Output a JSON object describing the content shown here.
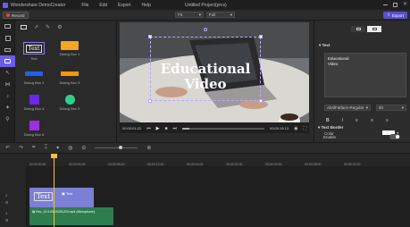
{
  "app": {
    "title": "Wondershare DemoCreator",
    "menus": [
      "File",
      "Edit",
      "Export",
      "Help"
    ],
    "project": "Untitled Project(prcs)"
  },
  "toolbar": {
    "record_label": "Record",
    "preview_mode": "Fit",
    "preview_quality": "Full",
    "export_label": "Export"
  },
  "library": {
    "tiles": [
      {
        "label": "Text",
        "preview": "Text",
        "color": "#ffffff"
      },
      {
        "label": "Dialog Box 1",
        "color": "#f5a623"
      },
      {
        "label": "Dialog Box 2",
        "color": "#1f5eff"
      },
      {
        "label": "Dialog Box 3",
        "color": "#ff9500"
      },
      {
        "label": "Dialog Box 4",
        "color": "#6a28e8"
      },
      {
        "label": "Dialog Box 5",
        "color": "#2fd08f"
      },
      {
        "label": "Dialog Box 6",
        "color": "#9b2fe0"
      }
    ]
  },
  "preview": {
    "line1": "Educational",
    "line2": "Video",
    "time_current": "00:00:01:22",
    "time_total": "00:00:18:13"
  },
  "properties": {
    "section_text": "Text",
    "text_value_line1": "Educational",
    "text_value_line2": "Video",
    "font_name": "AbrilFatface-Regular",
    "font_size": "80",
    "color_label": "Color",
    "border_section": "Text Border",
    "enable_label": "Enable"
  },
  "timeline": {
    "ticks": [
      "00:00:00:00",
      "00:00:04:00",
      "00:00:08:00",
      "00:00:12:00",
      "00:00:16:00",
      "00:00:20:00",
      "00:00:24:00",
      "00:00:28:00",
      "00:00:32:00"
    ],
    "text_clip_label": "Text",
    "text_clip_preview": "Text",
    "video_clip_label": "Rec_13.9.09 20201203.mp4 (Microphone)",
    "track_numbers": [
      "2",
      "1"
    ]
  },
  "colors": {
    "accent": "#6c5ce7",
    "text_clip": "#7b7fd6",
    "video_clip": "#2e7d4f",
    "playhead": "#f2c230"
  }
}
